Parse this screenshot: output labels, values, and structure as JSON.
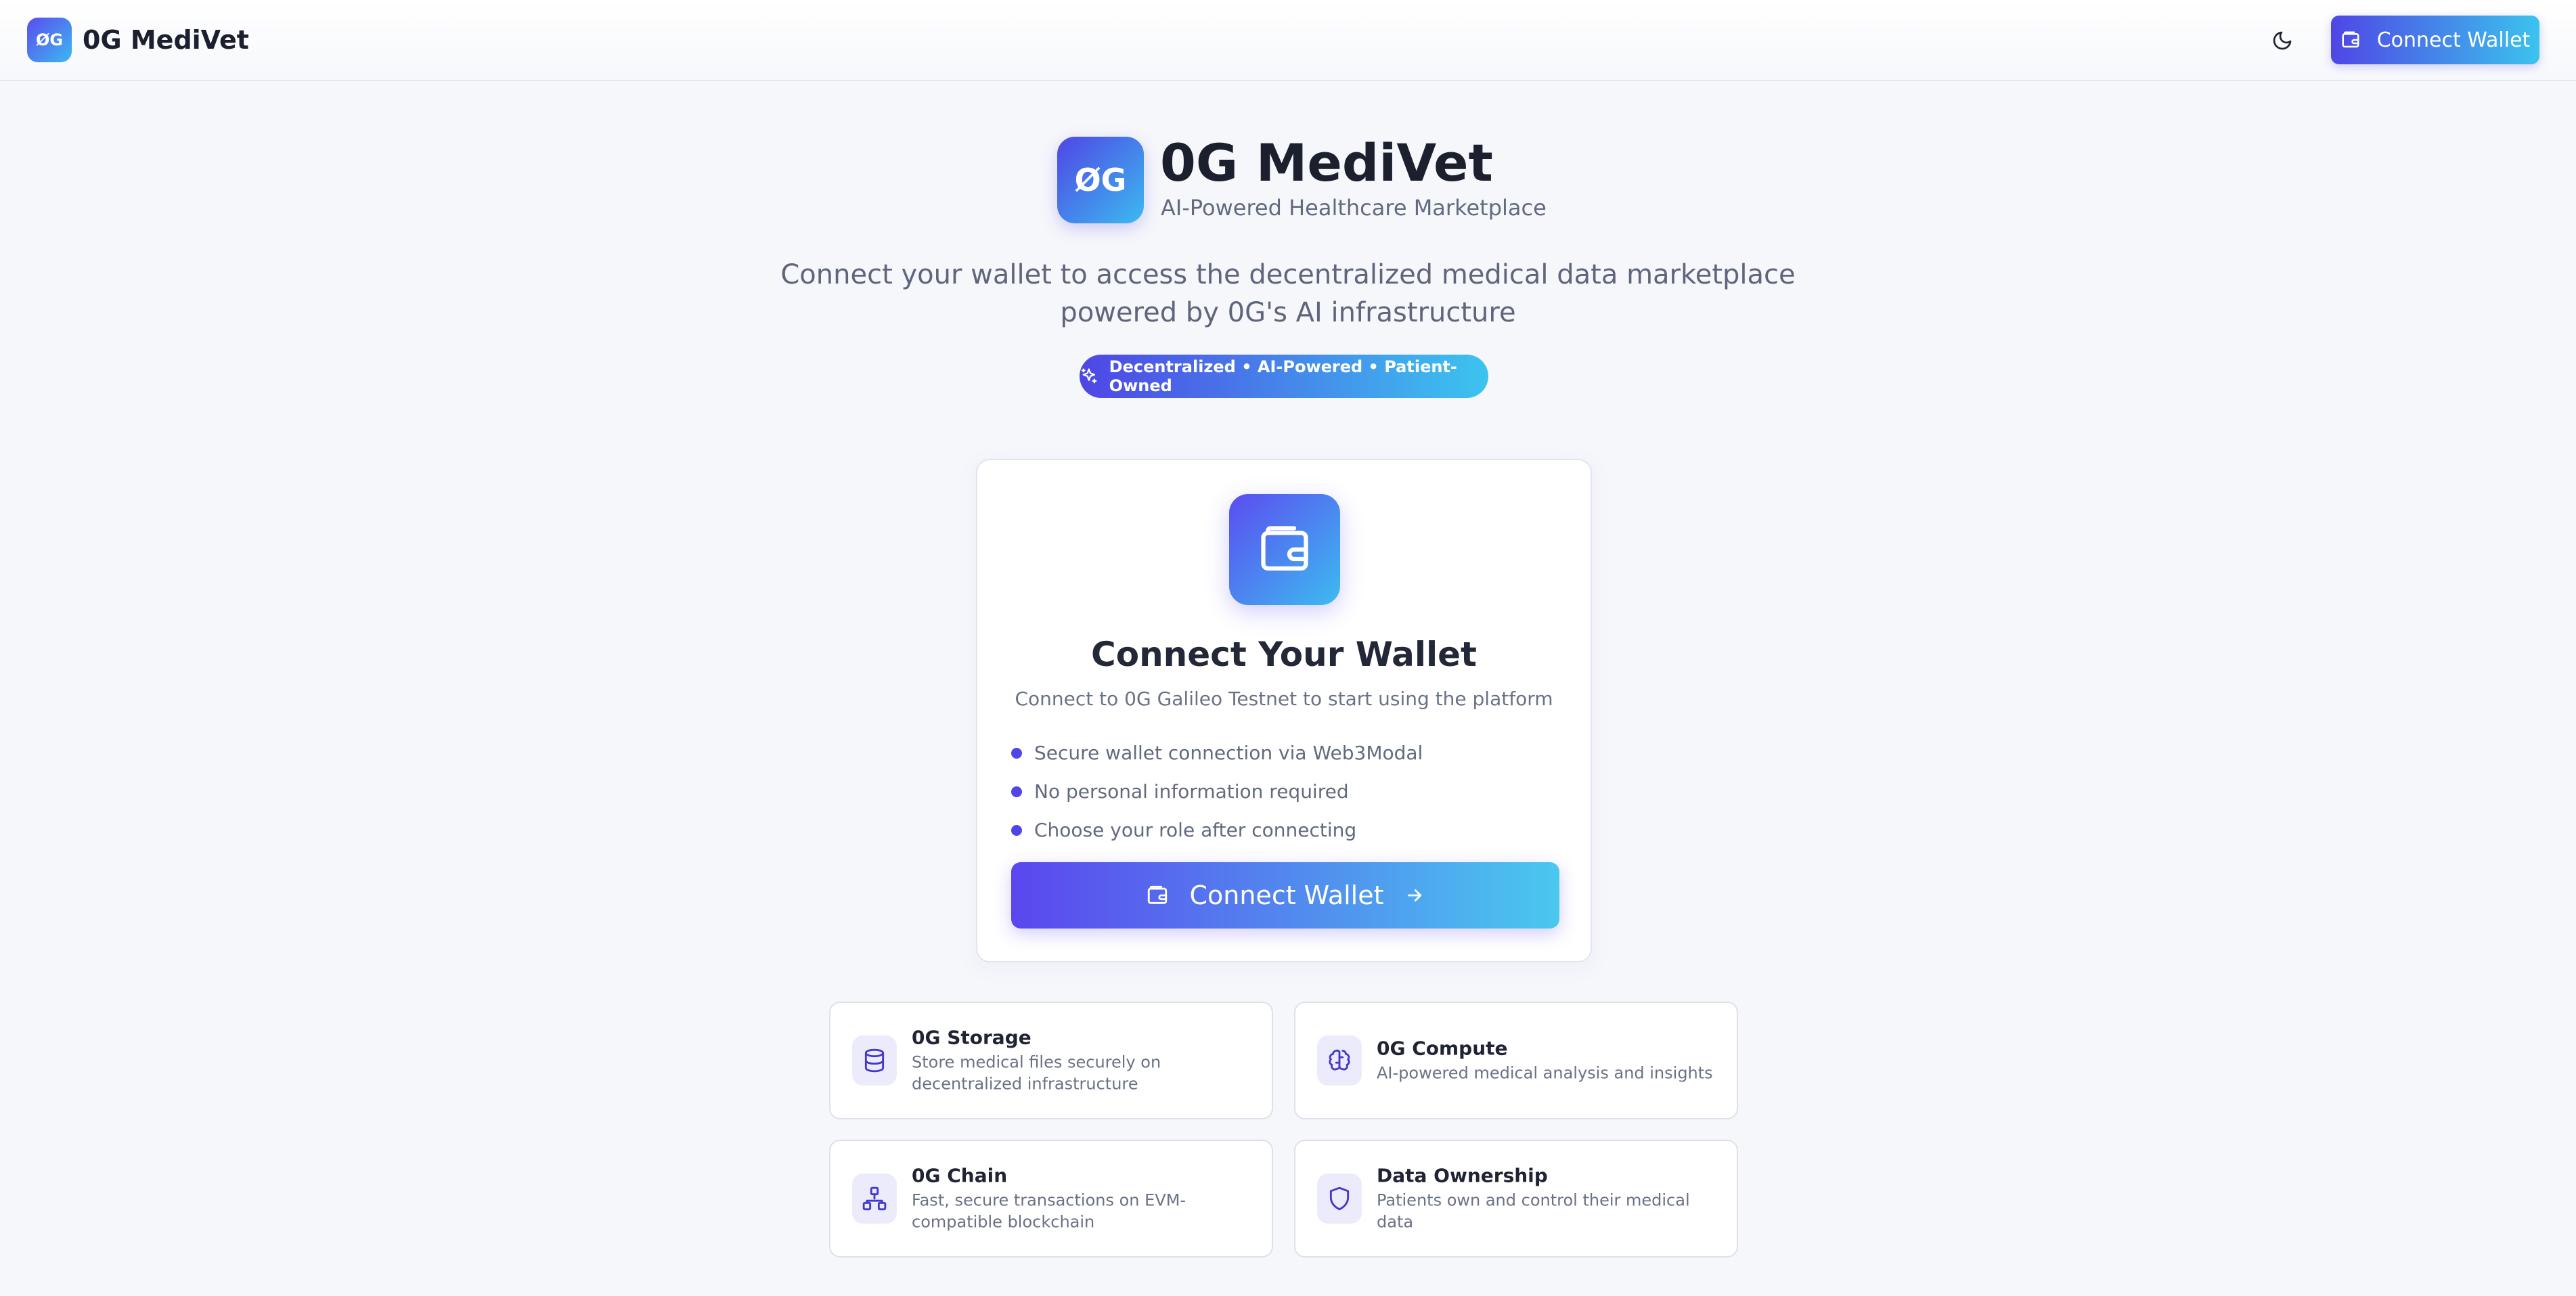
{
  "header": {
    "logo_text": "ØG",
    "brand_name": "0G MediVet",
    "theme_toggle_icon": "moon-icon",
    "connect_label": "Connect Wallet"
  },
  "hero": {
    "logo_text": "ØG",
    "title": "0G MediVet",
    "subtitle": "AI-Powered Healthcare Marketplace",
    "description": "Connect your wallet to access the decentralized medical data marketplace powered by 0G's AI infrastructure",
    "badge": "Decentralized • AI-Powered • Patient-Owned"
  },
  "card": {
    "icon": "wallet-icon",
    "title": "Connect Your Wallet",
    "subtitle": "Connect to 0G Galileo Testnet to start using the platform",
    "bullets": [
      "Secure wallet connection via Web3Modal",
      "No personal information required",
      "Choose your role after connecting"
    ],
    "button_label": "Connect Wallet"
  },
  "features": [
    {
      "icon": "database-icon",
      "title": "0G Storage",
      "desc": "Store medical files securely on decentralized infrastructure"
    },
    {
      "icon": "brain-icon",
      "title": "0G Compute",
      "desc": "AI-powered medical analysis and insights"
    },
    {
      "icon": "network-icon",
      "title": "0G Chain",
      "desc": "Fast, secure transactions on EVM-compatible blockchain"
    },
    {
      "icon": "shield-icon",
      "title": "Data Ownership",
      "desc": "Patients own and control their medical data"
    }
  ],
  "colors": {
    "accent_start": "#4f46e5",
    "accent_end": "#3cc4ef",
    "background": "#f6f7fb"
  }
}
